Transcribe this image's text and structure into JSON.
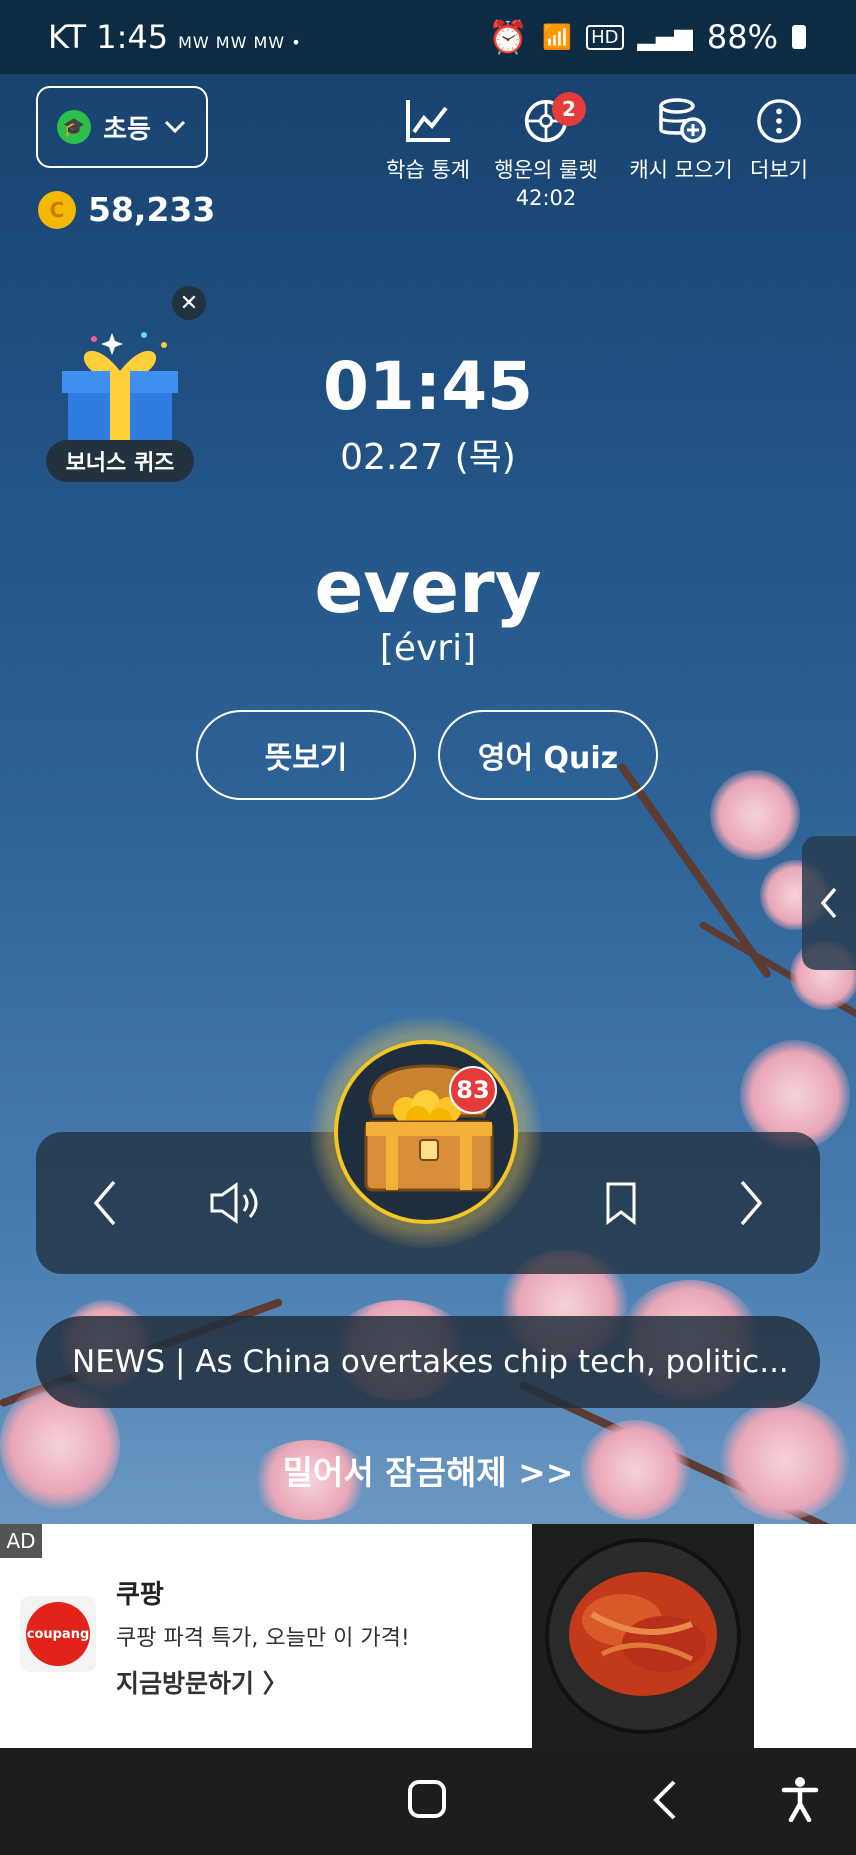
{
  "status": {
    "carrier_time": "KT 1:45",
    "notif_icons": "MW MW MW •",
    "battery": "88%"
  },
  "level": {
    "label": "초등"
  },
  "coins": {
    "coin_glyph": "C",
    "amount": "58,233"
  },
  "top_menu": [
    {
      "label": "학습 통계",
      "icon": "chart-icon"
    },
    {
      "label": "행운의 룰렛",
      "sub": "42:02",
      "badge": "2",
      "icon": "roulette-icon"
    },
    {
      "label": "캐시 모으기",
      "icon": "cash-stack-icon"
    },
    {
      "label": "더보기",
      "icon": "more-icon"
    }
  ],
  "bonus_quiz": {
    "label": "보너스 퀴즈"
  },
  "clock": {
    "time": "01:45",
    "date": "02.27 (목)"
  },
  "word": {
    "text": "every",
    "phonetic": "[évri]"
  },
  "buttons": {
    "meaning": "뜻보기",
    "quiz": "영어 Quiz"
  },
  "chest": {
    "badge": "83"
  },
  "news": {
    "text": "NEWS | As China overtakes chip tech, politic..."
  },
  "unlock": {
    "text": "밀어서 잠금해제 >>"
  },
  "ad": {
    "tag": "AD",
    "logo_text": "coupang",
    "name": "쿠팡",
    "desc": "쿠팡 파격 특가, 오늘만 이 가격!",
    "cta": "지금방문하기 〉"
  },
  "colors": {
    "accent_badge": "#e53b3b",
    "chest_ring": "#f3c623",
    "level_dot": "#2cbf4a"
  }
}
